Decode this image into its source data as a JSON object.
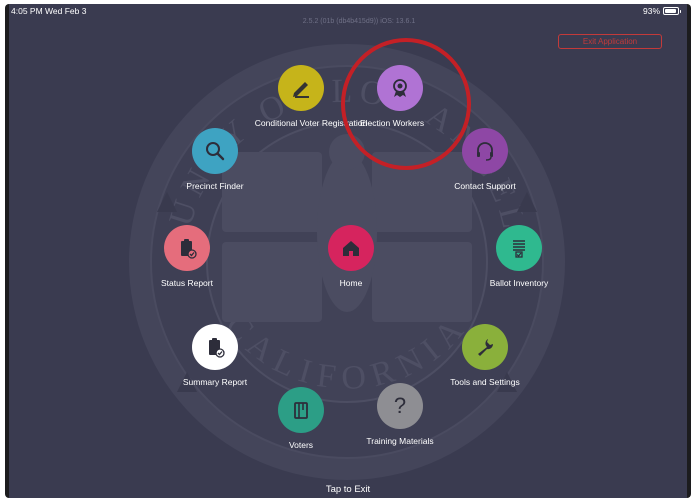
{
  "status_bar": {
    "time": "4:05 PM  Wed Feb 3",
    "battery": "93%"
  },
  "version": "2.5.2 (01b (db4b415d9)) iOS: 13.6.1",
  "exit_button": "Exit Application",
  "seal": {
    "top_text": "COUNTY OF LOS ANGELES",
    "bottom_text": "CALIFORNIA"
  },
  "menu": {
    "conditional": {
      "label": "Conditional Voter Registration",
      "color": "#c6b41a",
      "icon": "pen-icon"
    },
    "election_workers": {
      "label": "Election Workers",
      "color": "#b073d4",
      "icon": "ribbon-badge-icon"
    },
    "precinct_finder": {
      "label": "Precinct Finder",
      "color": "#3ea3c2",
      "icon": "search-icon"
    },
    "contact_support": {
      "label": "Contact Support",
      "color": "#8e47a5",
      "icon": "headset-icon"
    },
    "status_report": {
      "label": "Status Report",
      "color": "#e56d7c",
      "icon": "clipboard-check-icon"
    },
    "home": {
      "label": "Home",
      "color": "#d6245e",
      "icon": "home-icon"
    },
    "ballot_inventory": {
      "label": "Ballot Inventory",
      "color": "#2fb98f",
      "icon": "checklist-icon"
    },
    "summary_report": {
      "label": "Summary Report",
      "color": "#ffffff",
      "icon": "clipboard-check-icon"
    },
    "tools_settings": {
      "label": "Tools and Settings",
      "color": "#8ab03b",
      "icon": "wrench-icon"
    },
    "voters": {
      "label": "Voters",
      "color": "#2c9e86",
      "icon": "book-icon"
    },
    "training": {
      "label": "Training Materials",
      "color": "#8e8e93",
      "icon": "question-icon"
    }
  },
  "footer": "Tap to Exit"
}
